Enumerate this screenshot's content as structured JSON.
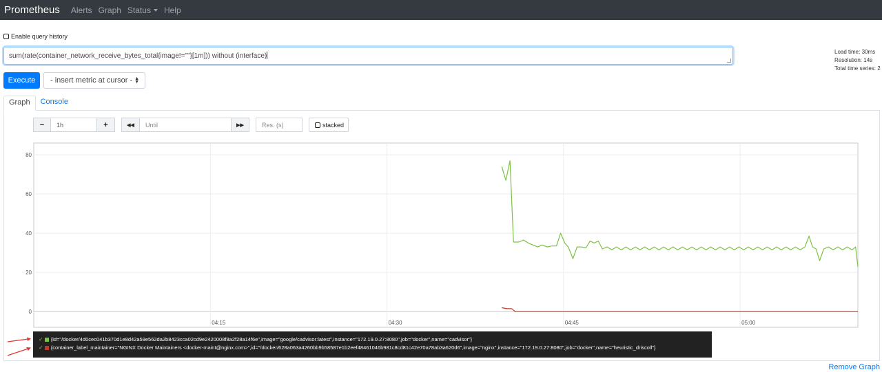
{
  "navbar": {
    "brand": "Prometheus",
    "links": [
      "Alerts",
      "Graph",
      "Status",
      "Help"
    ]
  },
  "query": {
    "history_label": "Enable query history",
    "expression": "sum(rate(container_network_receive_bytes_total{image!=\"\"}[1m])) without (interface)"
  },
  "stats": {
    "load_time": "Load time: 30ms",
    "resolution": "Resolution: 14s",
    "total_series": "Total time series: 2"
  },
  "actions": {
    "execute_label": "Execute",
    "metric_select": "- insert metric at cursor -"
  },
  "tabs": [
    "Graph",
    "Console"
  ],
  "controls": {
    "minus": "−",
    "range": "1h",
    "plus": "+",
    "back": "◀◀",
    "until_placeholder": "Until",
    "forward": "▶▶",
    "res_placeholder": "Res. (s)",
    "stacked_label": "stacked"
  },
  "chart_data": {
    "type": "line",
    "ylim": [
      -8,
      86
    ],
    "y_ticks": [
      0,
      20,
      40,
      60,
      80
    ],
    "x_tick_labels": [
      "04:15",
      "04:30",
      "04:45",
      "05:00"
    ],
    "x_tick_minutes": [
      15,
      30,
      45,
      60
    ],
    "x_range_minutes": [
      0,
      70
    ],
    "grid": true,
    "series": [
      {
        "label": "{id=\"/docker/4d0cec041b370d1e8d42a59e562da2b8423cca02cd9e2420008f8a2f28a14f6e\",image=\"google/cadvisor:latest\",instance=\"172.19.0.27:8080\",job=\"docker\",name=\"cadvisor\"}",
        "color": "#7cc142",
        "points": [
          [
            39.75,
            74
          ],
          [
            40.1,
            67
          ],
          [
            40.45,
            77
          ],
          [
            40.75,
            35.5
          ],
          [
            41.2,
            35.5
          ],
          [
            41.6,
            36.5
          ],
          [
            42.0,
            35
          ],
          [
            42.4,
            34
          ],
          [
            42.8,
            33
          ],
          [
            43.2,
            34
          ],
          [
            43.6,
            33
          ],
          [
            44.0,
            33.5
          ],
          [
            44.4,
            33.5
          ],
          [
            44.75,
            40
          ],
          [
            45.1,
            35
          ],
          [
            45.4,
            33
          ],
          [
            45.8,
            27
          ],
          [
            46.15,
            33
          ],
          [
            46.5,
            33
          ],
          [
            46.9,
            32.5
          ],
          [
            47.25,
            36
          ],
          [
            47.6,
            35
          ],
          [
            47.95,
            36
          ],
          [
            48.3,
            32
          ],
          [
            48.7,
            33
          ],
          [
            49.1,
            31.5
          ],
          [
            49.5,
            33
          ],
          [
            49.9,
            31.5
          ],
          [
            50.3,
            33
          ],
          [
            50.7,
            31.5
          ],
          [
            51.1,
            33
          ],
          [
            51.5,
            31.5
          ],
          [
            51.9,
            33
          ],
          [
            52.3,
            31.5
          ],
          [
            52.7,
            33
          ],
          [
            53.1,
            31.5
          ],
          [
            53.5,
            33
          ],
          [
            53.9,
            31.5
          ],
          [
            54.3,
            33
          ],
          [
            54.7,
            31.5
          ],
          [
            55.1,
            33
          ],
          [
            55.5,
            31.5
          ],
          [
            55.9,
            33
          ],
          [
            56.3,
            31.5
          ],
          [
            56.7,
            33
          ],
          [
            57.1,
            31.5
          ],
          [
            57.5,
            33
          ],
          [
            57.9,
            31.5
          ],
          [
            58.3,
            33
          ],
          [
            58.7,
            31.5
          ],
          [
            59.1,
            33
          ],
          [
            59.5,
            31.5
          ],
          [
            59.9,
            33
          ],
          [
            60.3,
            31.5
          ],
          [
            60.7,
            33
          ],
          [
            61.1,
            31.5
          ],
          [
            61.5,
            33
          ],
          [
            61.9,
            31.5
          ],
          [
            62.3,
            33
          ],
          [
            62.7,
            31.5
          ],
          [
            63.1,
            33
          ],
          [
            63.5,
            31.5
          ],
          [
            63.9,
            33
          ],
          [
            64.3,
            31.5
          ],
          [
            64.7,
            33
          ],
          [
            65.1,
            31.5
          ],
          [
            65.5,
            33
          ],
          [
            65.85,
            38.5
          ],
          [
            66.15,
            33
          ],
          [
            66.45,
            32
          ],
          [
            66.75,
            26
          ],
          [
            67.1,
            32
          ],
          [
            67.5,
            33
          ],
          [
            67.9,
            31.5
          ],
          [
            68.3,
            33
          ],
          [
            68.7,
            31.5
          ],
          [
            69.1,
            33
          ],
          [
            69.5,
            31.5
          ],
          [
            69.8,
            33
          ],
          [
            70.0,
            23
          ]
        ]
      },
      {
        "label": "{container_label_maintainer=\"NGINX Docker Maintainers <docker-maint@nginx.com>\",id=\"/docker/628a063a4260bb9b58587e1b2eef48461046b981c8cd81c42e70a78ab3a620d6\",image=\"nginx\",instance=\"172.19.0.27:8080\",job=\"docker\",name=\"heuristic_driscoll\"}",
        "color": "#c0392b",
        "points": [
          [
            39.75,
            2
          ],
          [
            40.2,
            1.5
          ],
          [
            40.6,
            1.5
          ],
          [
            40.9,
            0
          ],
          [
            70.0,
            0
          ]
        ]
      }
    ]
  },
  "remove_label": "Remove Graph"
}
